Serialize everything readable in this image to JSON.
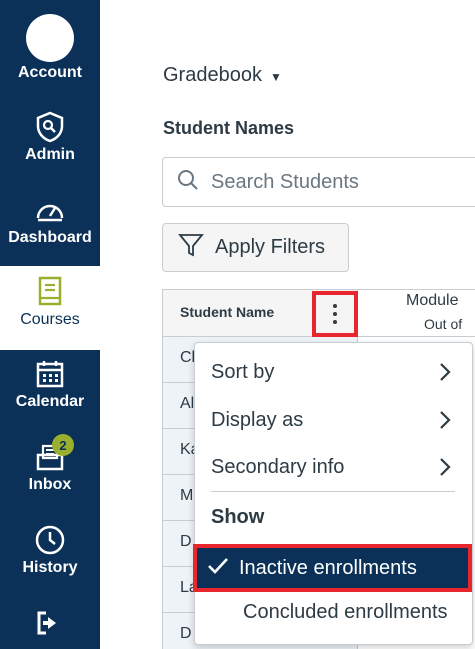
{
  "nav": {
    "account": "Account",
    "admin": "Admin",
    "dashboard": "Dashboard",
    "courses": "Courses",
    "calendar": "Calendar",
    "inbox": "Inbox",
    "inbox_badge": "2",
    "history": "History"
  },
  "breadcrumb": {
    "label": "Gradebook"
  },
  "section": {
    "title": "Student Names"
  },
  "search": {
    "placeholder": "Search Students"
  },
  "filters": {
    "label": "Apply Filters"
  },
  "grid": {
    "student_header": "Student Name",
    "module_header": "Module",
    "module_sub": "Out of",
    "rows": [
      "Cl",
      "Al",
      "Ka",
      "M",
      "D",
      "La",
      "D"
    ]
  },
  "menu": {
    "sort_by": "Sort by",
    "display_as": "Display as",
    "secondary_info": "Secondary info",
    "show": "Show",
    "inactive": "Inactive enrollments",
    "concluded": "Concluded enrollments"
  },
  "colors": {
    "nav_bg": "#0b3158",
    "highlight_red": "#e8262d",
    "badge": "#9aaf2d",
    "courses_icon": "#9aaf2d"
  }
}
